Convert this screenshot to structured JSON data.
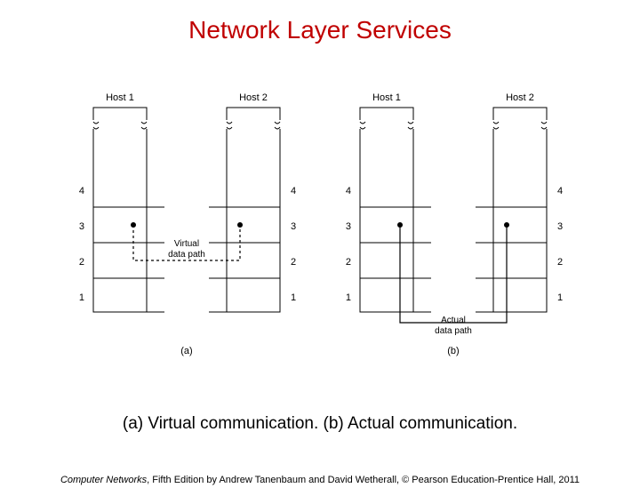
{
  "title": "Network Layer Services",
  "caption": "(a) Virtual communication. (b) Actual communication.",
  "footer_book": "Computer Networks",
  "footer_rest": ", Fifth Edition by Andrew Tanenbaum and David Wetherall, © Pearson Education-Prentice Hall, 2011",
  "diagram": {
    "hosts": {
      "h1": "Host 1",
      "h2": "Host 2"
    },
    "layers": [
      "4",
      "3",
      "2",
      "1"
    ],
    "virtual_label_l1": "Virtual",
    "virtual_label_l2": "data path",
    "actual_label_l1": "Actual",
    "actual_label_l2": "data path",
    "sub_a": "(a)",
    "sub_b": "(b)"
  }
}
